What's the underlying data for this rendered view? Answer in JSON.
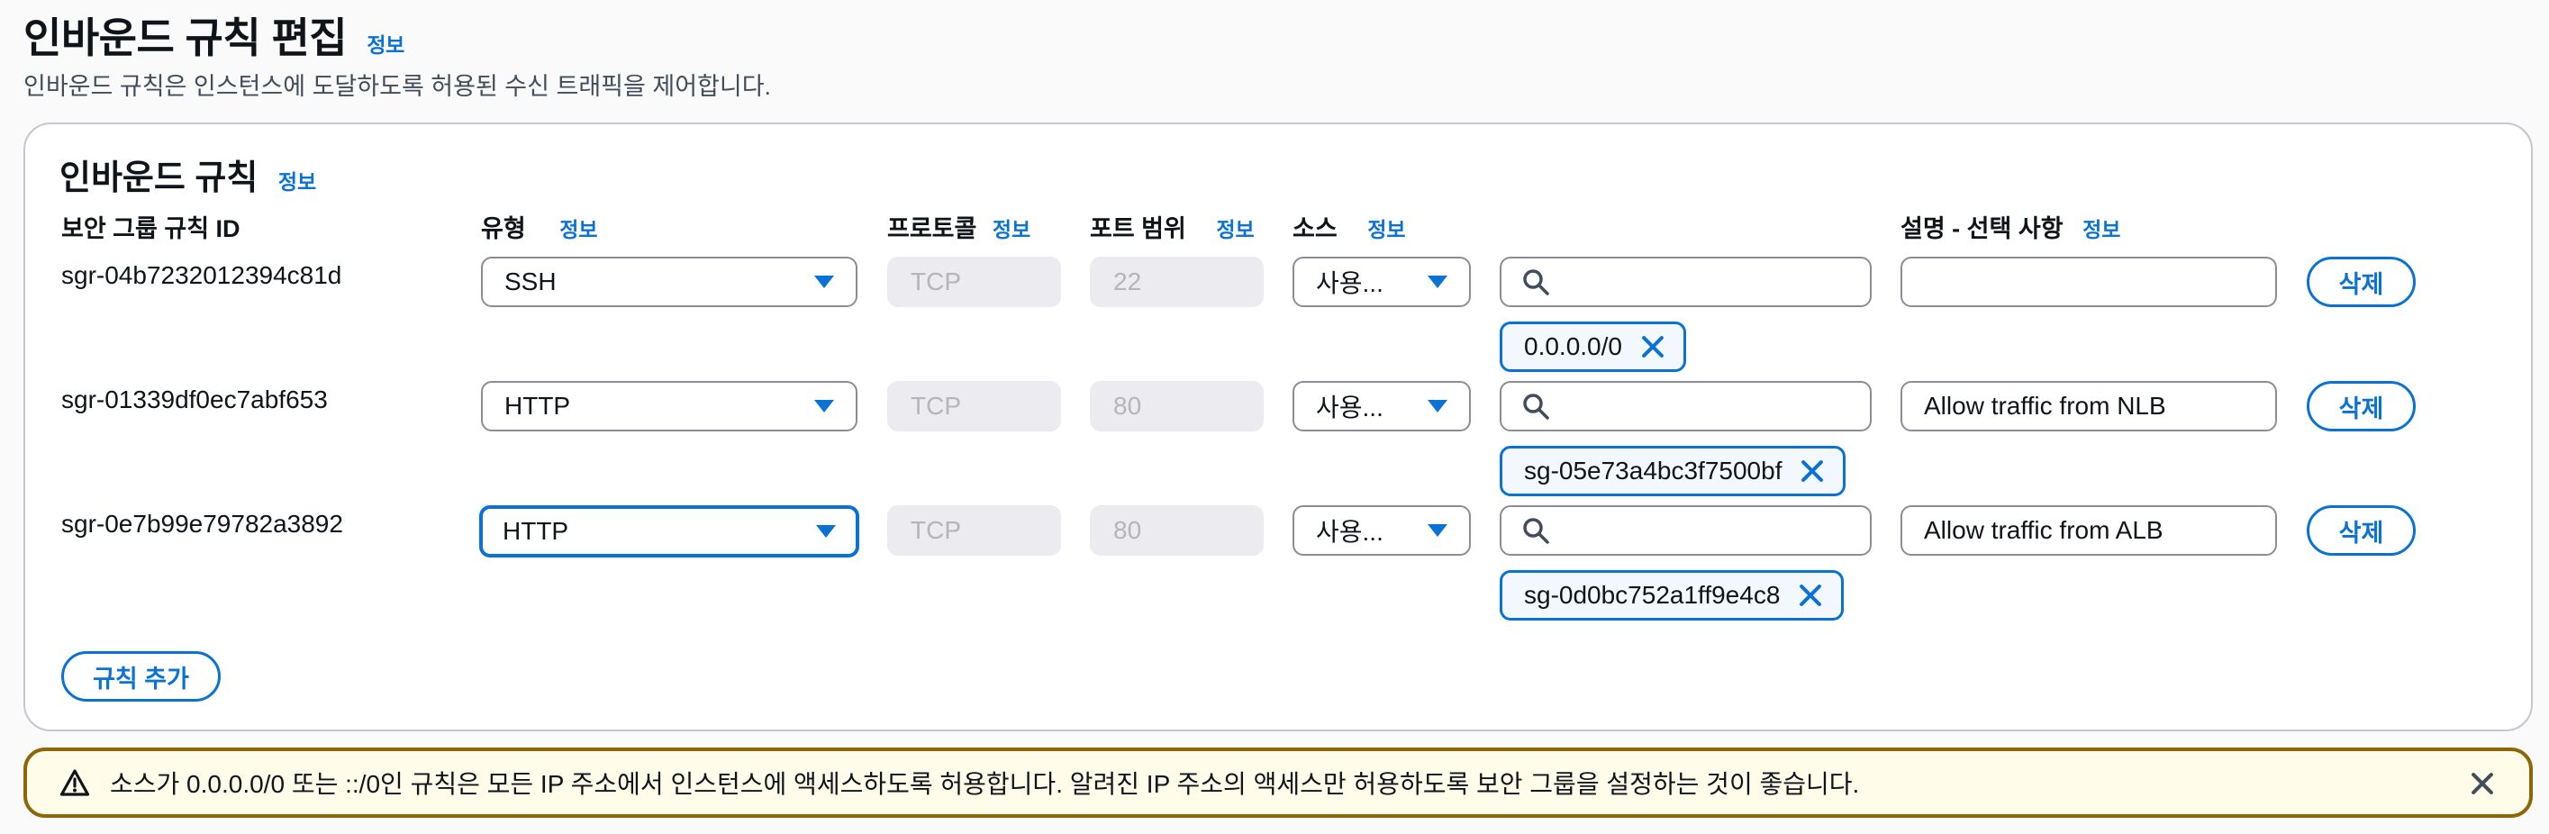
{
  "header": {
    "title": "인바운드 규칙 편집",
    "info": "정보",
    "description": "인바운드 규칙은 인스턴스에 도달하도록 허용된 수신 트래픽을 제어합니다."
  },
  "panel": {
    "title": "인바운드 규칙",
    "info": "정보",
    "columns": {
      "rule_id": "보안 그룹 규칙 ID",
      "type": "유형",
      "protocol": "프로토콜",
      "port_range": "포트 범위",
      "source": "소스",
      "description": "설명 - 선택 사항",
      "info": "정보"
    },
    "rules": [
      {
        "id": "sgr-04b7232012394c81d",
        "type": "SSH",
        "protocol": "TCP",
        "port": "22",
        "source_type": "사용...",
        "search_value": "",
        "token": "0.0.0.0/0",
        "description": "",
        "delete_label": "삭제"
      },
      {
        "id": "sgr-01339df0ec7abf653",
        "type": "HTTP",
        "protocol": "TCP",
        "port": "80",
        "source_type": "사용...",
        "search_value": "",
        "token": "sg-05e73a4bc3f7500bf",
        "description": "Allow traffic from NLB",
        "delete_label": "삭제"
      },
      {
        "id": "sgr-0e7b99e79782a3892",
        "type": "HTTP",
        "protocol": "TCP",
        "port": "80",
        "source_type": "사용...",
        "search_value": "",
        "token": "sg-0d0bc752a1ff9e4c8",
        "description": "Allow traffic from ALB",
        "delete_label": "삭제"
      }
    ],
    "add_rule_label": "규칙 추가"
  },
  "alert": {
    "text": "소스가 0.0.0.0/0 또는 ::/0인 규칙은 모든 IP 주소에서 인스턴스에 액세스하도록 허용합니다. 알려진 IP 주소의 액세스만 허용하도록 보안 그룹을 설정하는 것이 좋습니다.",
    "icon": "warning-icon",
    "border_color": "#8d6605",
    "background": "#fffce9"
  },
  "colors": {
    "accent": "#0972d3",
    "text": "#0f141a",
    "disabled_bg": "#ebebf0"
  }
}
